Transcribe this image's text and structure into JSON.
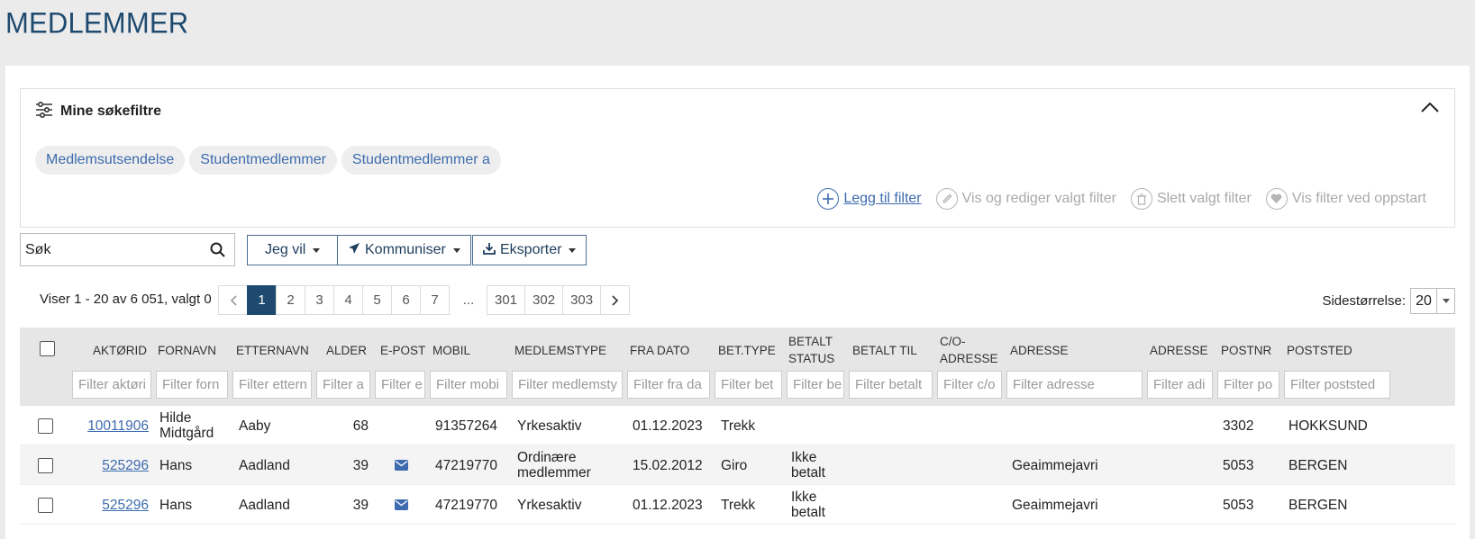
{
  "page": {
    "title": "MEDLEMMER"
  },
  "filters": {
    "title": "Mine søkefiltre",
    "chips": [
      "Medlemsutsendelse",
      "Studentmedlemmer",
      "Studentmedlemmer a"
    ],
    "actions": [
      {
        "label": "Legg til filter",
        "icon": "plus-circle-icon",
        "enabled": true
      },
      {
        "label": "Vis og rediger valgt filter",
        "icon": "pencil-icon",
        "enabled": false
      },
      {
        "label": "Slett valgt filter",
        "icon": "trash-icon",
        "enabled": false
      },
      {
        "label": "Vis filter ved oppstart",
        "icon": "heart-icon",
        "enabled": false
      }
    ]
  },
  "toolbar": {
    "search_placeholder": "Søk",
    "jeg_vil": "Jeg vil",
    "kommuniser": "Kommuniser",
    "eksporter": "Eksporter"
  },
  "pagination": {
    "summary": "Viser 1 - 20 av 6 051, valgt 0",
    "pages": [
      "1",
      "2",
      "3",
      "4",
      "5",
      "6",
      "7"
    ],
    "ellipsis": "...",
    "last_pages": [
      "301",
      "302",
      "303"
    ],
    "current": "1",
    "page_size_label": "Sidestørrelse:",
    "page_size": "20"
  },
  "table": {
    "columns": [
      {
        "key": "aktorid",
        "label": "AKTØRID",
        "filter": "Filter aktøri"
      },
      {
        "key": "fornavn",
        "label": "FORNAVN",
        "filter": "Filter forn"
      },
      {
        "key": "etternavn",
        "label": "ETTERNAVN",
        "filter": "Filter ettern"
      },
      {
        "key": "alder",
        "label": "ALDER",
        "filter": "Filter a"
      },
      {
        "key": "epost",
        "label": "E-POST",
        "filter": "Filter e"
      },
      {
        "key": "mobil",
        "label": "MOBIL",
        "filter": "Filter mobi"
      },
      {
        "key": "medlemstype",
        "label": "MEDLEMSTYPE",
        "filter": "Filter medlemsty"
      },
      {
        "key": "fradato",
        "label": "FRA DATO",
        "filter": "Filter fra da"
      },
      {
        "key": "bettype",
        "label": "BET.TYPE",
        "filter": "Filter bet"
      },
      {
        "key": "betaltstatus",
        "label": "BETALT STATUS",
        "filter": "Filter be"
      },
      {
        "key": "betalttil",
        "label": "BETALT TIL",
        "filter": "Filter betalt"
      },
      {
        "key": "coadresse",
        "label": "C/O-ADRESSE",
        "filter": "Filter c/o"
      },
      {
        "key": "adresse",
        "label": "ADRESSE",
        "filter": "Filter adresse"
      },
      {
        "key": "adresse2",
        "label": "ADRESSE",
        "filter": "Filter adi"
      },
      {
        "key": "postnr",
        "label": "POSTNR",
        "filter": "Filter po"
      },
      {
        "key": "poststed",
        "label": "POSTSTED",
        "filter": "Filter poststed"
      }
    ],
    "rows": [
      {
        "aktorid": "10011906",
        "fornavn": "Hilde Midtgård",
        "etternavn": "Aaby",
        "alder": "68",
        "epost": false,
        "mobil": "91357264",
        "medlemstype": "Yrkesaktiv",
        "fradato": "01.12.2023",
        "bettype": "Trekk",
        "betaltstatus": "",
        "betalttil": "",
        "coadresse": "",
        "adresse": "",
        "adresse2": "",
        "postnr": "3302",
        "poststed": "HOKKSUND"
      },
      {
        "aktorid": "525296",
        "fornavn": "Hans",
        "etternavn": "Aadland",
        "alder": "39",
        "epost": true,
        "mobil": "47219770",
        "medlemstype": "Ordinære medlemmer",
        "fradato": "15.02.2012",
        "bettype": "Giro",
        "betaltstatus": "Ikke betalt",
        "betalttil": "",
        "coadresse": "",
        "adresse": "Geaimmejavri",
        "adresse2": "",
        "postnr": "5053",
        "poststed": "BERGEN"
      },
      {
        "aktorid": "525296",
        "fornavn": "Hans",
        "etternavn": "Aadland",
        "alder": "39",
        "epost": true,
        "mobil": "47219770",
        "medlemstype": "Yrkesaktiv",
        "fradato": "01.12.2023",
        "bettype": "Trekk",
        "betaltstatus": "Ikke betalt",
        "betalttil": "",
        "coadresse": "",
        "adresse": "Geaimmejavri",
        "adresse2": "",
        "postnr": "5053",
        "poststed": "BERGEN"
      }
    ]
  }
}
